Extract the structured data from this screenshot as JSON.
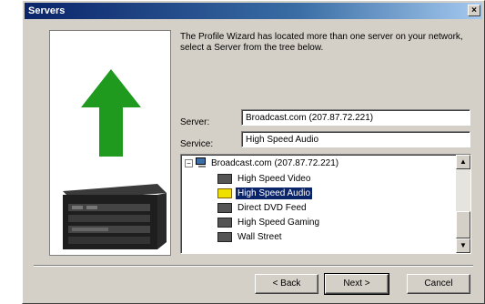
{
  "window": {
    "title": "Servers"
  },
  "description": "The Profile Wizard has located more than one server on your network, select a Server from the tree below.",
  "server_field": {
    "label": "Server:",
    "value": "Broadcast.com (207.87.72.221)"
  },
  "service_field": {
    "label": "Service:",
    "value": "High Speed Audio"
  },
  "tree": {
    "root": "Broadcast.com (207.87.72.221)",
    "items": [
      {
        "label": "High Speed Video",
        "selected": false
      },
      {
        "label": "High Speed Audio",
        "selected": true
      },
      {
        "label": "Direct DVD Feed",
        "selected": false
      },
      {
        "label": "High Speed Gaming",
        "selected": false
      },
      {
        "label": "Wall Street",
        "selected": false
      }
    ]
  },
  "buttons": {
    "back": "< Back",
    "next": "Next >",
    "cancel": "Cancel"
  },
  "icons": {
    "arrow": "up-arrow-icon",
    "device": "server-rack-icon",
    "close": "close-icon"
  },
  "colors": {
    "arrow": "#1f9a1f",
    "selection": "#0a246a",
    "titlebar": "#0a246a"
  }
}
